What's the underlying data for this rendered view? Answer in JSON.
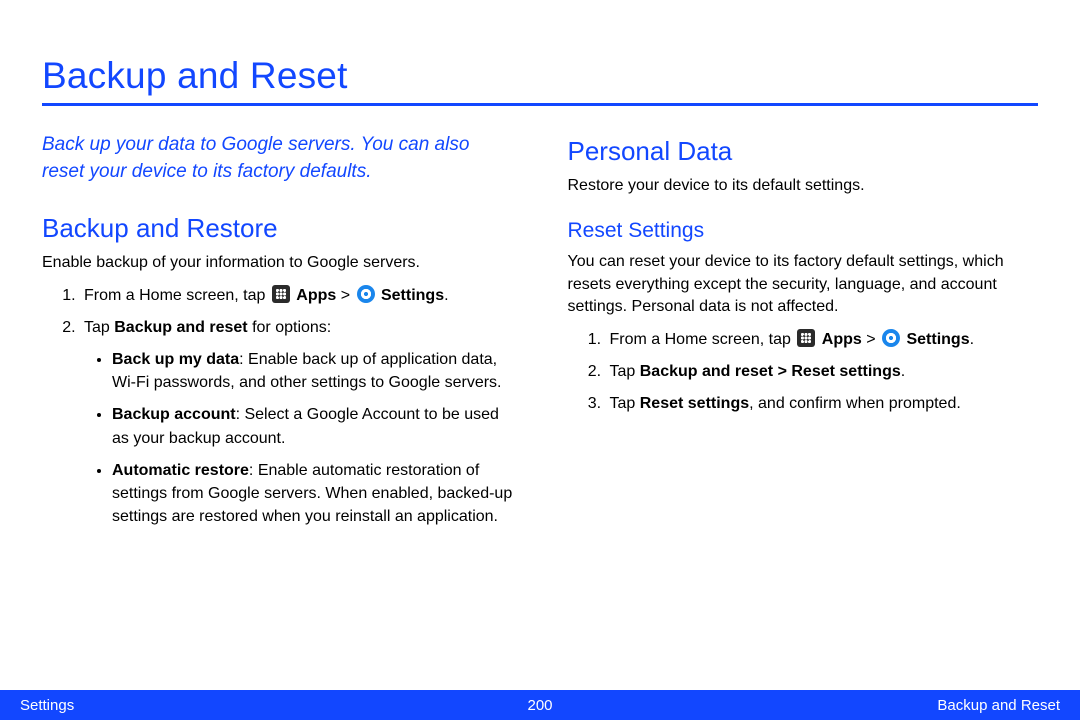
{
  "title": "Backup and Reset",
  "intro": "Back up your data to Google servers. You can also reset your device to its factory defaults.",
  "left": {
    "heading": "Backup and Restore",
    "lead": "Enable backup of your information to Google servers.",
    "step1_prefix": "From a Home screen, tap ",
    "apps_label": "Apps",
    "gt": " > ",
    "settings_label": "Settings",
    "period": ".",
    "step2_prefix": "Tap ",
    "step2_bold": "Backup and reset",
    "step2_suffix": " for options:",
    "b1_label": "Back up my data",
    "b1_text": ": Enable back up of application data, Wi-Fi passwords, and other settings to Google servers.",
    "b2_label": "Backup account",
    "b2_text": ": Select a Google Account to be used as your backup account.",
    "b3_label": "Automatic restore",
    "b3_text": ": Enable automatic restoration of settings from Google servers. When enabled, backed-up settings are restored when you reinstall an application."
  },
  "right": {
    "heading": "Personal Data",
    "lead": "Restore your device to its default settings.",
    "sub": "Reset Settings",
    "paragraph": "You can reset your device to its factory default settings, which resets everything except the security, language, and account settings. Personal data is not affected.",
    "step1_prefix": "From a Home screen, tap ",
    "apps_label": "Apps",
    "gt": " > ",
    "settings_label": "Settings",
    "period": ".",
    "step2_prefix": "Tap ",
    "step2_bold": "Backup and reset > Reset settings",
    "step2_suffix": ".",
    "step3_prefix": "Tap ",
    "step3_bold": "Reset settings",
    "step3_suffix": ", and confirm when prompted."
  },
  "footer": {
    "left": "Settings",
    "center": "200",
    "right": "Backup and Reset"
  }
}
